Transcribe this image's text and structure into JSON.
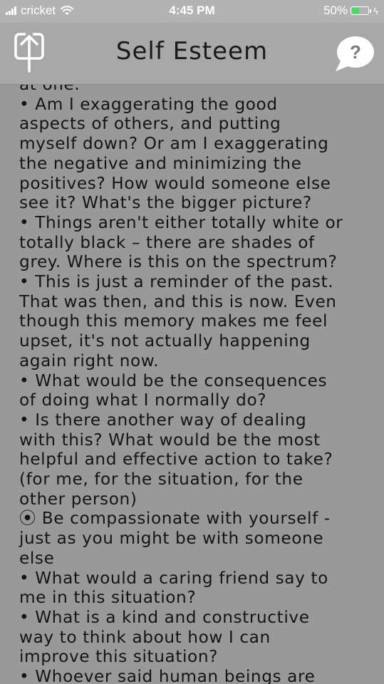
{
  "status_bar": {
    "carrier": "cricket",
    "time": "4:45 PM",
    "battery_percent": "50%",
    "battery_level": 0.5,
    "battery_color": "#4cd964"
  },
  "nav": {
    "title": "Self Esteem",
    "share_icon": "share-icon",
    "help_icon": "question-bubble-icon",
    "help_glyph": "?"
  },
  "content": {
    "lines": [
      "at one.",
      "• Am I exaggerating the good",
      "aspects of others, and putting",
      "myself down? Or am I exaggerating",
      "the negative and minimizing the",
      "positives? How would someone else",
      "see it? What's the bigger picture?",
      "• Things aren't either totally white or",
      "totally black – there are shades of",
      "grey. Where is this on the spectrum?",
      "• This is just a reminder of the past.",
      "That was then, and this is now. Even",
      "though this memory makes me feel",
      "upset, it's not actually happening",
      "again right now.",
      "• What would be the consequences",
      "of doing what I normally do?",
      "• Is there another way of dealing",
      "with this? What would be the most",
      "helpful and effective action to take?",
      "(for me, for the situation, for the",
      "other person)",
      "⦿ Be compassionate with yourself -",
      "just as you might be with someone",
      "else",
      "• What would a caring friend say to",
      "me in this situation?",
      "• What is a kind and constructive",
      "way to think about how I can",
      "improve this situation?",
      "• Whoever said human beings are"
    ]
  }
}
